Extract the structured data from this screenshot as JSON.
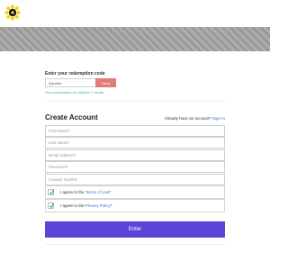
{
  "header": {
    "logo_icon": "sun-flower-icon",
    "logo_colors": {
      "petals": "#f2d600",
      "center": "#1a1a1a"
    },
    "banner_color": "#a9a9a9"
  },
  "redemption": {
    "label": "Enter your redemption code",
    "code_value": "Qandeb",
    "clear_label": "Clear",
    "valid_message": "Your subscription is valid for 1 month"
  },
  "account": {
    "title": "Create Account",
    "already_text": "Already have an account?",
    "signin_label": "Sign In"
  },
  "fields": {
    "first_name": "First Name*",
    "last_name": "Last Name*",
    "email": "Email Address*",
    "password": "Password*",
    "contact": "Contact Number"
  },
  "terms": {
    "agree_prefix": "I agree to the",
    "terms_link": "Terms of Use",
    "privacy_link": "Privacy Policy",
    "suffix": "*",
    "check_icon": "check-icon"
  },
  "submit": {
    "label": "Enter"
  },
  "colors": {
    "accent": "#5a45d8",
    "clear_button": "#e27b79",
    "success": "#2bb673",
    "link": "#3b6fd1",
    "check": "#2bb673"
  }
}
